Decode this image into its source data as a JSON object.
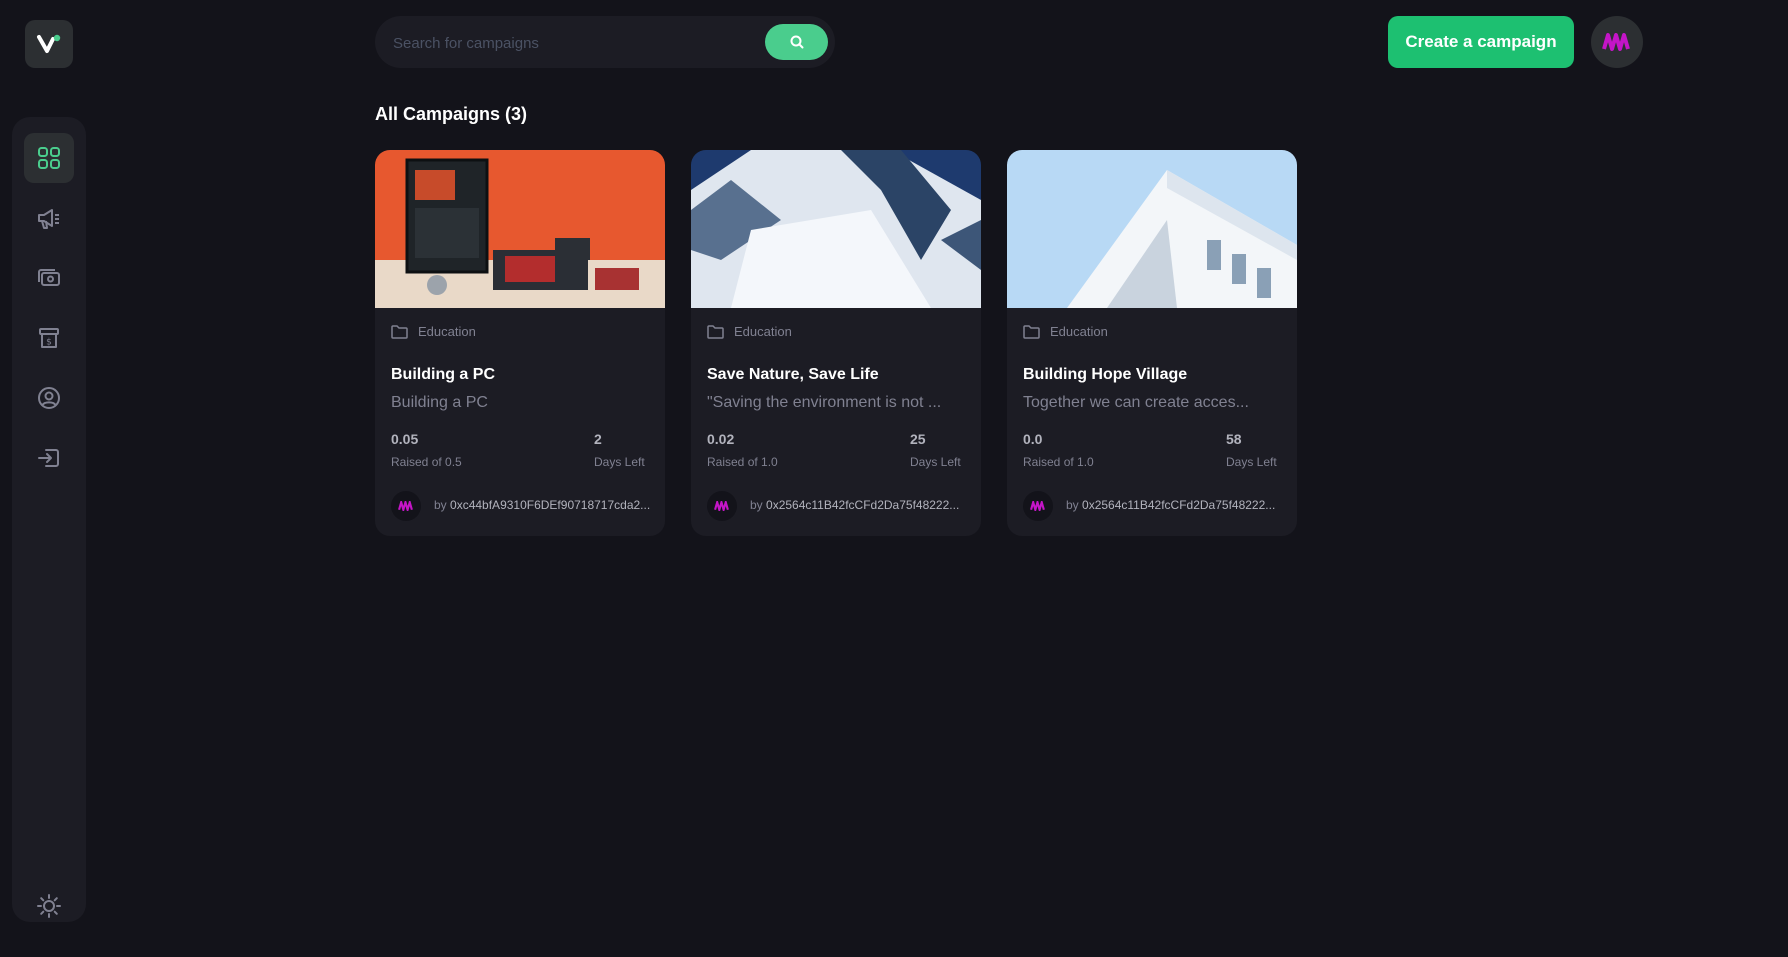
{
  "header": {
    "search_placeholder": "Search for campaigns",
    "create_button_label": "Create a campaign"
  },
  "sidebar": {
    "items": [
      {
        "icon": "dashboard-grid-icon",
        "active": true
      },
      {
        "icon": "megaphone-icon",
        "active": false
      },
      {
        "icon": "payment-icon",
        "active": false
      },
      {
        "icon": "withdraw-icon",
        "active": false
      },
      {
        "icon": "profile-icon",
        "active": false
      },
      {
        "icon": "logout-icon",
        "active": false
      }
    ],
    "footer_icon": "sun-icon"
  },
  "main": {
    "title": "All Campaigns (3)",
    "campaigns": [
      {
        "category": "Education",
        "title": "Building a PC",
        "description": "Building a PC",
        "raised": "0.05",
        "raised_label": "Raised of 0.5",
        "days_left": "2",
        "days_label": "Days Left",
        "owner_prefix": "by",
        "owner": "0xc44bfA9310F6DEf90718717cda2..."
      },
      {
        "category": "Education",
        "title": "Save Nature, Save Life",
        "description": "\"Saving the environment is not ...",
        "raised": "0.02",
        "raised_label": "Raised of 1.0",
        "days_left": "25",
        "days_label": "Days Left",
        "owner_prefix": "by",
        "owner": "0x2564c11B42fcCFd2Da75f48222..."
      },
      {
        "category": "Education",
        "title": "Building Hope Village",
        "description": "Together we can create acces...",
        "raised": "0.0",
        "raised_label": "Raised of 1.0",
        "days_left": "58",
        "days_label": "Days Left",
        "owner_prefix": "by",
        "owner": "0x2564c11B42fcCFd2Da75f48222..."
      }
    ]
  },
  "colors": {
    "background": "#13131a",
    "panel": "#1c1c24",
    "accent": "#1dc071",
    "search_accent": "#4acd8d",
    "muted_text": "#808191",
    "avatar_brand": "#c415c7"
  }
}
